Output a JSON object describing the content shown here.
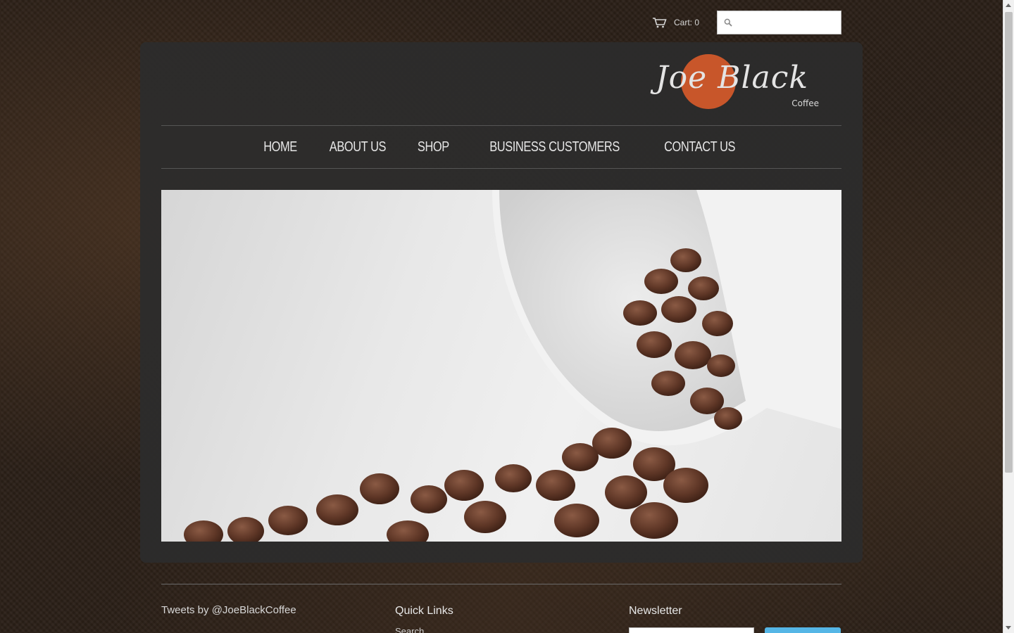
{
  "header": {
    "cart_label": "Cart: 0",
    "search_placeholder": ""
  },
  "logo": {
    "name": "Joe Black",
    "sub": "Coffee"
  },
  "nav": {
    "items": [
      "HOME",
      "ABOUT US",
      "SHOP",
      "BUSINESS CUSTOMERS",
      "CONTACT US"
    ]
  },
  "hero": {
    "description": ""
  },
  "footer": {
    "tweets_label": "Tweets by @JoeBlackCoffee",
    "quick_links_title": "Quick Links",
    "quick_links": [
      "Search"
    ],
    "newsletter_title": "Newsletter"
  },
  "colors": {
    "accent": "#c8562a",
    "panel": "#2c2c2c",
    "button": "#55b6e6"
  }
}
